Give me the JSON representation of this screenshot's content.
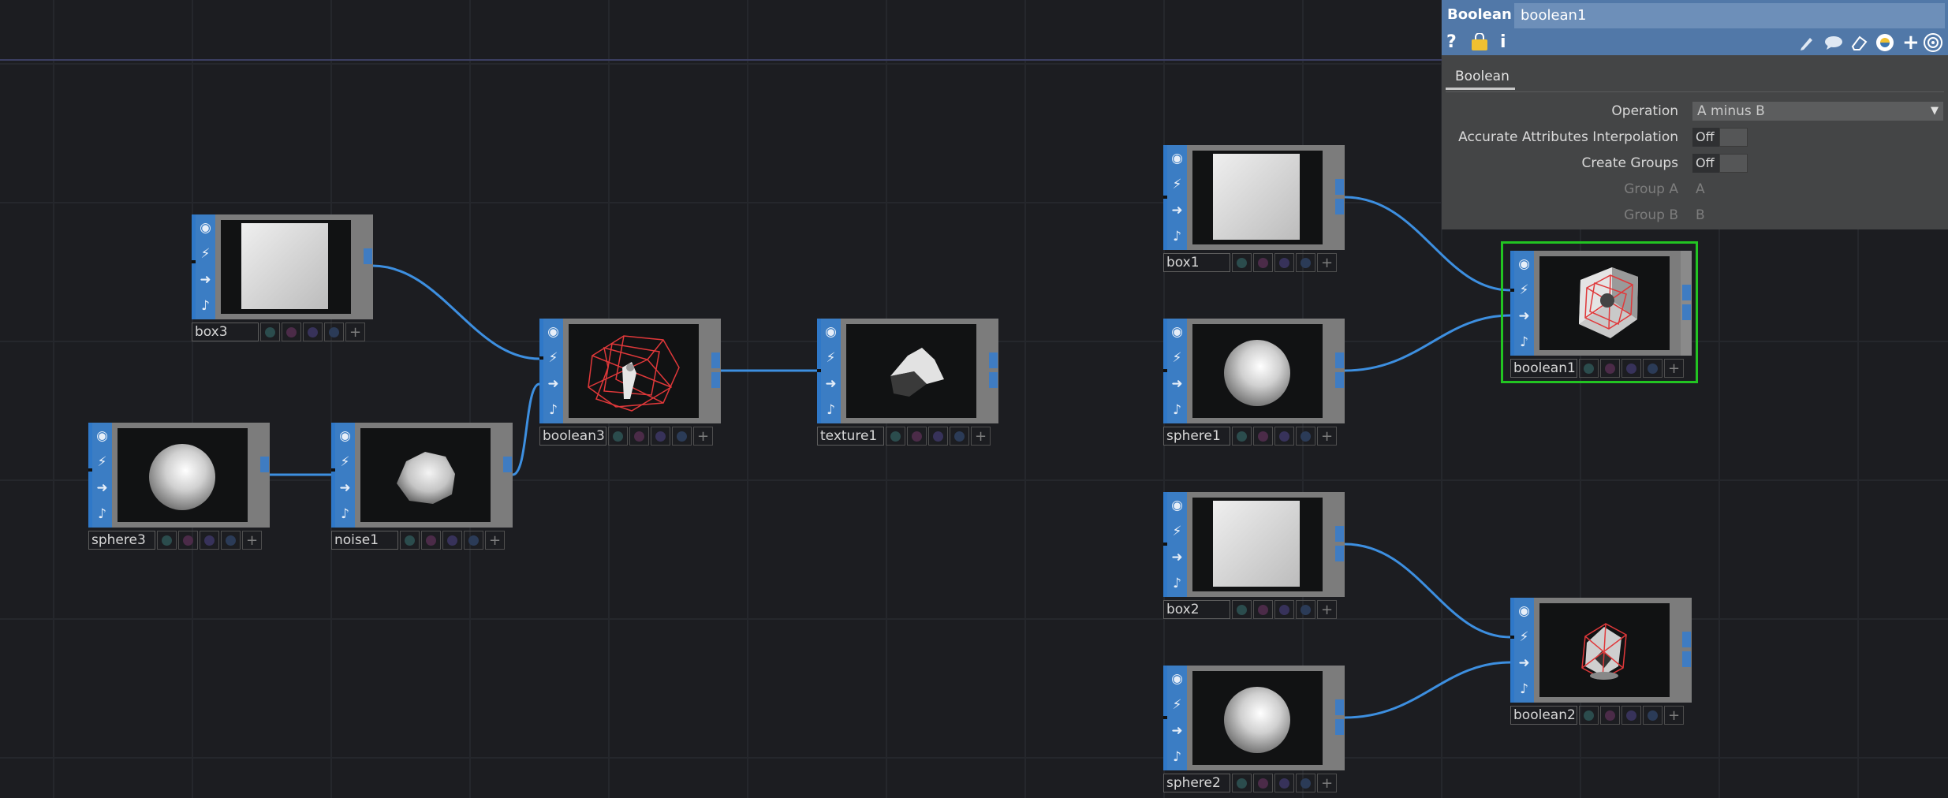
{
  "network": {
    "nodes": [
      {
        "name": "box3",
        "preview": "box"
      },
      {
        "name": "sphere3",
        "preview": "sphere"
      },
      {
        "name": "noise1",
        "preview": "noise"
      },
      {
        "name": "boolean3",
        "preview": "boolean-wire"
      },
      {
        "name": "texture1",
        "preview": "texture"
      },
      {
        "name": "box1",
        "preview": "box"
      },
      {
        "name": "sphere1",
        "preview": "sphere"
      },
      {
        "name": "boolean1",
        "preview": "boolean-cube",
        "selected": true
      },
      {
        "name": "box2",
        "preview": "box"
      },
      {
        "name": "sphere2",
        "preview": "sphere"
      },
      {
        "name": "boolean2",
        "preview": "boolean-small"
      }
    ],
    "connections": [
      [
        "box3",
        "boolean3"
      ],
      [
        "sphere3",
        "noise1"
      ],
      [
        "noise1",
        "boolean3"
      ],
      [
        "boolean3",
        "texture1"
      ],
      [
        "box1",
        "boolean1"
      ],
      [
        "sphere1",
        "boolean1"
      ],
      [
        "box2",
        "boolean2"
      ],
      [
        "sphere2",
        "boolean2"
      ]
    ],
    "node_icons": [
      "viewer-icon",
      "bypass-icon",
      "lock-icon",
      "cook-icon"
    ],
    "flag_plus": "+",
    "colors": {
      "wire": "#3d8fe0",
      "selected": "#22c422",
      "node_strip": "#3b7dc4"
    }
  },
  "param_panel": {
    "op_type": "Boolean",
    "op_name": "boolean1",
    "toolbar": {
      "help": "?",
      "python_help": "python-help-icon",
      "info": "i",
      "right_icons": [
        "pencil-icon",
        "comment-icon",
        "eraser-icon",
        "python-icon",
        "add-icon",
        "target-icon"
      ],
      "add": "+"
    },
    "tabs": [
      "Boolean"
    ],
    "params": {
      "operation": {
        "label": "Operation",
        "value": "A minus B"
      },
      "accurate": {
        "label": "Accurate Attributes Interpolation",
        "value": "Off"
      },
      "create_groups": {
        "label": "Create Groups",
        "value": "Off"
      },
      "group_a": {
        "label": "Group A",
        "value": "A"
      },
      "group_b": {
        "label": "Group B",
        "value": "B"
      }
    }
  }
}
